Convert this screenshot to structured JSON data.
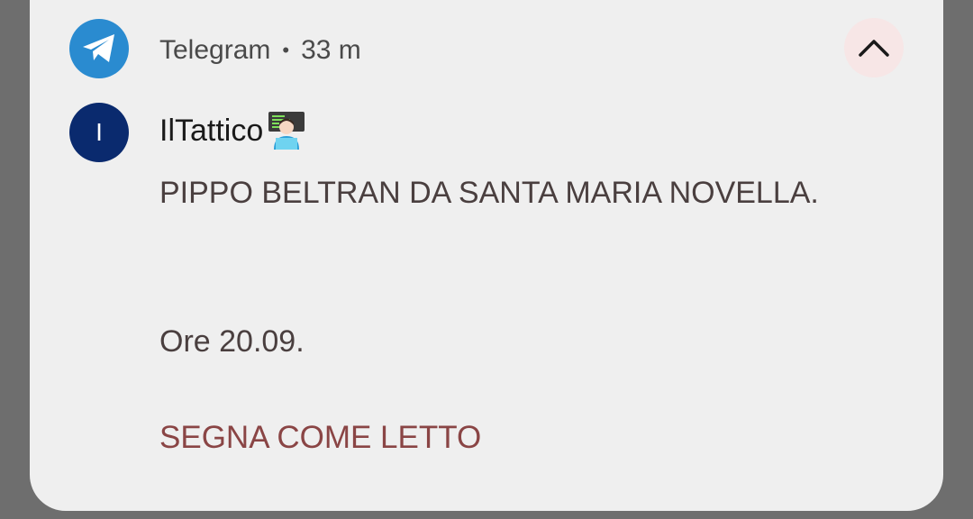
{
  "notification": {
    "app_name": "Telegram",
    "separator": "•",
    "time_ago": "33 m",
    "app_icon": "telegram-paper-plane-icon",
    "collapse_icon": "chevron-up-icon",
    "avatar_letter": "I",
    "sender_name": "IlTattico",
    "sender_emoji": "technologist-emoji",
    "message_lines": [
      "PIPPO BELTRAN DA SANTA MARIA NOVELLA.",
      "",
      "Ore 20.09."
    ],
    "action_label": "SEGNA COME LETTO"
  },
  "colors": {
    "background": "#6e6e6e",
    "card": "#efefef",
    "telegram_blue": "#2a8bd0",
    "avatar_navy": "#0a2a6e",
    "action_red": "#8a4545",
    "collapse_bg": "#f7e6e6"
  }
}
